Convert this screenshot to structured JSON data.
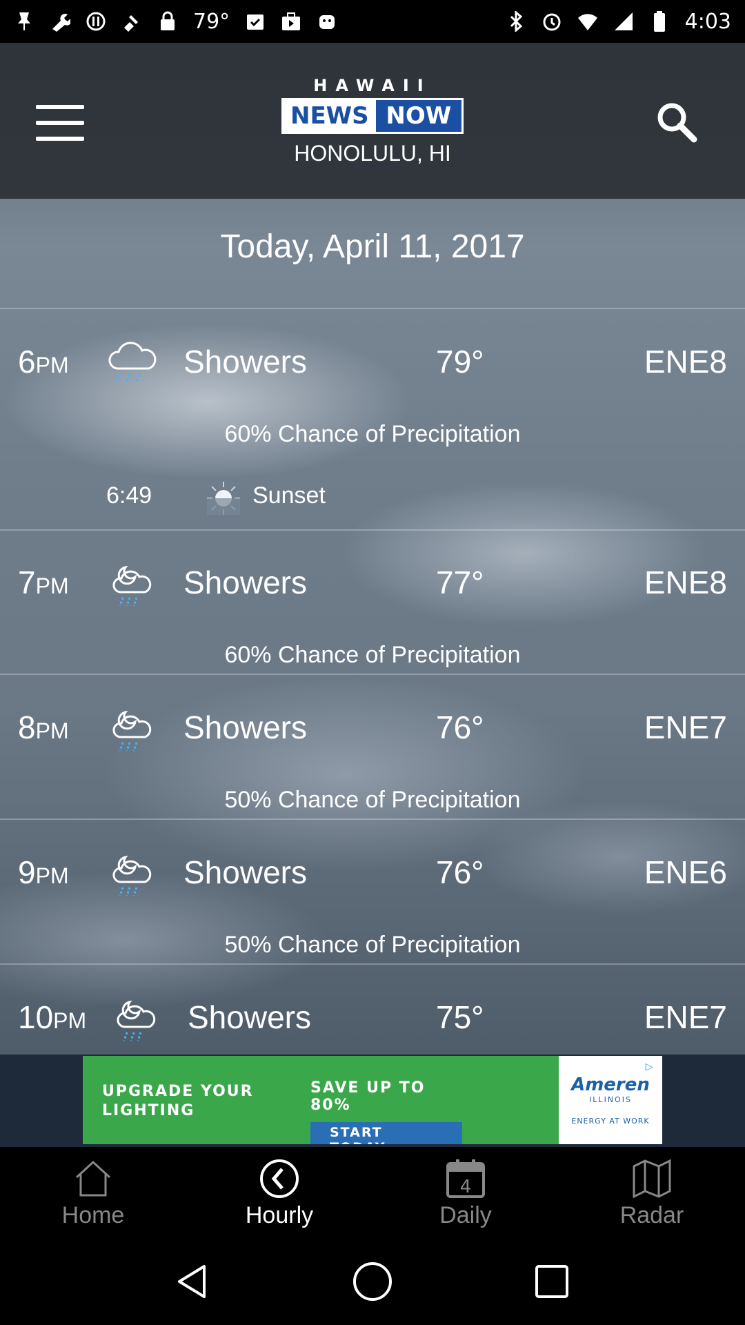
{
  "status_bar": {
    "temp": "79°",
    "time": "4:03"
  },
  "header": {
    "logo_top": "HAWAII",
    "logo_news": "NEWS",
    "logo_now": "NOW",
    "location": "HONOLULU, HI"
  },
  "date_heading": "Today, April 11, 2017",
  "hours": [
    {
      "hour": "6",
      "ampm": "PM",
      "condition": "Showers",
      "temp": "79°",
      "wind": "ENE8",
      "precip": "60% Chance of Precipitation",
      "icon": "cloud-rain-icon"
    },
    {
      "hour": "7",
      "ampm": "PM",
      "condition": "Showers",
      "temp": "77°",
      "wind": "ENE8",
      "precip": "60% Chance of Precipitation",
      "icon": "moon-cloud-rain-icon"
    },
    {
      "hour": "8",
      "ampm": "PM",
      "condition": "Showers",
      "temp": "76°",
      "wind": "ENE7",
      "precip": "50% Chance of Precipitation",
      "icon": "moon-cloud-rain-icon"
    },
    {
      "hour": "9",
      "ampm": "PM",
      "condition": "Showers",
      "temp": "76°",
      "wind": "ENE6",
      "precip": "50% Chance of Precipitation",
      "icon": "moon-cloud-rain-icon"
    },
    {
      "hour": "10",
      "ampm": "PM",
      "condition": "Showers",
      "temp": "75°",
      "wind": "ENE7",
      "icon": "moon-cloud-rain-icon"
    }
  ],
  "sunset": {
    "time": "6:49",
    "label": "Sunset"
  },
  "ad": {
    "headline": "UPGRADE YOUR LIGHTING",
    "save": "SAVE UP TO 80%",
    "cta": "START TODAY",
    "brand": "Ameren",
    "brand_sub": "ILLINOIS",
    "tagline": "ENERGY AT WORK"
  },
  "bottom_nav": {
    "home": "Home",
    "hourly": "Hourly",
    "daily": "Daily",
    "daily_badge": "4",
    "radar": "Radar",
    "active": "hourly"
  },
  "colors": {
    "brand_blue": "#1a4fa3",
    "rain_blue": "#3fb6ff",
    "ad_green": "#3aa84a"
  }
}
